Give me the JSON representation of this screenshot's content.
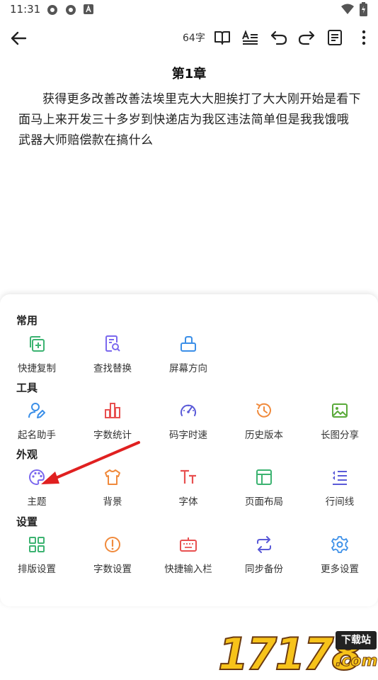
{
  "status": {
    "time": "11:31"
  },
  "toolbar": {
    "word_count": "64字"
  },
  "chapter": {
    "title": "第1章",
    "text": "获得更多改善改善法埃里克大大胆挨打了大大刚开始是看下面马上来开发三十多岁到快递店为我区违法简单但是我我饿哦武器大师赔偿款在搞什么"
  },
  "panel": {
    "sections": [
      {
        "title": "常用",
        "items": [
          {
            "label": "快捷复制",
            "icon": "copy-add-icon",
            "color": "#3cb371"
          },
          {
            "label": "查找替换",
            "icon": "find-replace-icon",
            "color": "#7b68ee"
          },
          {
            "label": "屏幕方向",
            "icon": "screen-rotate-icon",
            "color": "#3b8fe8"
          }
        ]
      },
      {
        "title": "工具",
        "items": [
          {
            "label": "起名助手",
            "icon": "name-assistant-icon",
            "color": "#3b8fe8"
          },
          {
            "label": "字数统计",
            "icon": "bar-chart-icon",
            "color": "#e85050"
          },
          {
            "label": "码字时速",
            "icon": "speedometer-icon",
            "color": "#5a5ad8"
          },
          {
            "label": "历史版本",
            "icon": "history-icon",
            "color": "#f08a3c"
          },
          {
            "label": "长图分享",
            "icon": "image-icon",
            "color": "#5aaa3a"
          }
        ]
      },
      {
        "title": "外观",
        "items": [
          {
            "label": "主题",
            "icon": "palette-icon",
            "color": "#7b68ee"
          },
          {
            "label": "背景",
            "icon": "tshirt-icon",
            "color": "#f08a3c"
          },
          {
            "label": "字体",
            "icon": "font-icon",
            "color": "#e85050"
          },
          {
            "label": "页面布局",
            "icon": "layout-icon",
            "color": "#3cb371"
          },
          {
            "label": "行间线",
            "icon": "line-spacing-icon",
            "color": "#5a5ad8"
          }
        ]
      },
      {
        "title": "设置",
        "items": [
          {
            "label": "排版设置",
            "icon": "grid-icon",
            "color": "#3cb371"
          },
          {
            "label": "字数设置",
            "icon": "alert-circle-icon",
            "color": "#f08a3c"
          },
          {
            "label": "快捷输入栏",
            "icon": "keyboard-icon",
            "color": "#e85050"
          },
          {
            "label": "同步备份",
            "icon": "sync-icon",
            "color": "#5a5ad8"
          },
          {
            "label": "更多设置",
            "icon": "gear-icon",
            "color": "#3b8fe8"
          }
        ]
      }
    ]
  },
  "watermark": {
    "number": "17178",
    "badge": "下载站",
    "domain": ".com"
  }
}
